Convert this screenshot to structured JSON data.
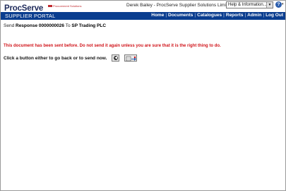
{
  "header": {
    "logo_text": "ProcServe",
    "logo_subtext": "Procurement Solutions",
    "user_info": "Derek Bailey - ProcServe Supplier Solutions Limited",
    "help_select": "Help & Information..."
  },
  "nav": {
    "portal_title": "SUPPLIER PORTAL",
    "links": [
      "Home",
      "Documents",
      "Catalogues",
      "Reports",
      "Admin",
      "Log Out"
    ],
    "separator": "|"
  },
  "content": {
    "send_prefix": "Send",
    "document": "Response 0000000026",
    "to_label": "To",
    "recipient": "SP Trading PLC",
    "warning": "This document has been sent before. Do not send it again unless you are sure that it is the right thing to do.",
    "instruction": "Click a button either to go back or to send now."
  },
  "colors": {
    "nav_background": "#0a3d8f",
    "warning_text": "#d0141a"
  }
}
